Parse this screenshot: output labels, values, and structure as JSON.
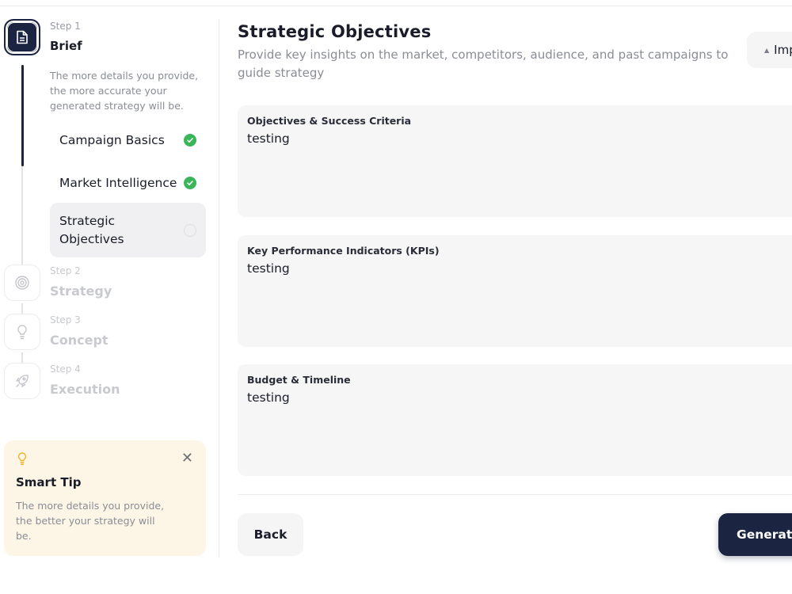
{
  "steps": [
    {
      "label": "Step 1",
      "title": "Brief",
      "icon": "document-icon",
      "status": "active",
      "description": "The more details you provide, the more accurate your generated strategy will be."
    },
    {
      "label": "Step 2",
      "title": "Strategy",
      "icon": "target-icon",
      "status": "inactive"
    },
    {
      "label": "Step 3",
      "title": "Concept",
      "icon": "lightbulb-icon",
      "status": "inactive"
    },
    {
      "label": "Step 4",
      "title": "Execution",
      "icon": "rocket-icon",
      "status": "inactive"
    }
  ],
  "brief_substeps": [
    {
      "label": "Campaign Basics",
      "status": "complete"
    },
    {
      "label": "Market Intelligence",
      "status": "complete"
    },
    {
      "label": "Strategic Objectives",
      "status": "current"
    }
  ],
  "tip": {
    "title": "Smart Tip",
    "text": "The more details you provide, the better your strategy will be.",
    "close": "✕"
  },
  "main": {
    "title": "Strategic Objectives",
    "subtitle": "Provide key insights on the market, competitors, audience, and past campaigns to guide strategy",
    "import_label": "Import",
    "fields": [
      {
        "label": "Objectives & Success Criteria",
        "value": "testing"
      },
      {
        "label": "Key Performance Indicators (KPIs)",
        "value": "testing"
      },
      {
        "label": "Budget & Timeline",
        "value": "testing"
      }
    ],
    "back_label": "Back",
    "generate_label": "Generate Strategy"
  },
  "colors": {
    "primary": "#1b2440",
    "success": "#3bb55a",
    "tip_bg": "#fdf6e6",
    "tip_icon": "#f0b429"
  }
}
